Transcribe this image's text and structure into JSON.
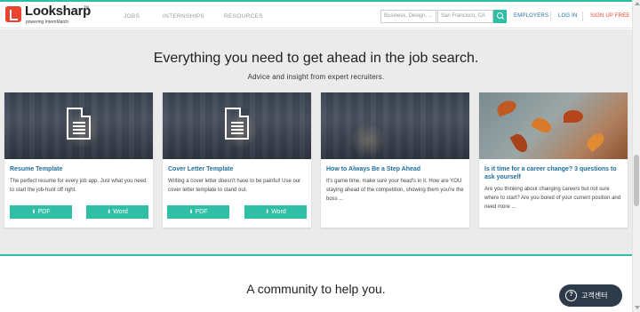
{
  "header": {
    "logo_text": "Looksharp",
    "logo_tm": "TM",
    "logo_sub": "powering InternMatch",
    "nav": [
      "JOBS",
      "INTERNSHIPS",
      "RESOURCES"
    ],
    "search_keywords_placeholder": "Business, Design, ...",
    "search_location_placeholder": "San Francisco, CA",
    "employers": "EMPLOYERS",
    "login": "LOG IN",
    "signup": "SIGN UP FREE"
  },
  "hero": {
    "headline": "Everything you need to get ahead in the job search.",
    "subline": "Advice and insight from expert recruiters."
  },
  "cards": [
    {
      "title": "Resume Template",
      "desc": "The perfect resume for every job app. Just what you need to start the job-hunt off right.",
      "buttons": [
        "PDF",
        "Word"
      ]
    },
    {
      "title": "Cover Letter Template",
      "desc": "Writing a cover letter doesn't have to be painful! Use our cover letter template to stand out.",
      "buttons": [
        "PDF",
        "Word"
      ]
    },
    {
      "title": "How to Always Be a Step Ahead",
      "desc": "It's game time, make sure your head's in it. How are YOU staying ahead of the competition, showing them you're the boss ..."
    },
    {
      "title": "Is it time for a career change? 3 questions to ask yourself",
      "desc": "Are you thinking about changing careers but not sure where to start? Are you bored of your current position and need more ..."
    }
  ],
  "community": "A community to help you.",
  "help_button": "고객센터",
  "help_icon_glyph": "?",
  "colors": {
    "accent": "#2ebfa5",
    "link": "#1f6f9a",
    "signup": "#e9442e"
  }
}
